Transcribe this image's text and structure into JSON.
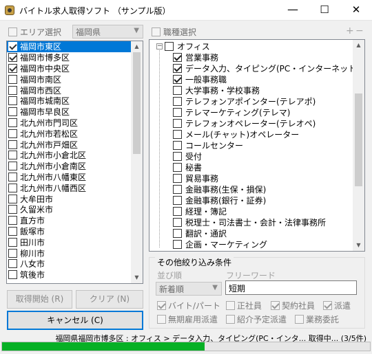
{
  "window": {
    "title": "バイトル求人取得ソフト （サンプル版）",
    "minimize": "—",
    "maximize": "☐",
    "close": "✕"
  },
  "area": {
    "checkbox_label": "エリア選択",
    "checked": false,
    "prefecture": "福岡県"
  },
  "area_list": [
    {
      "label": "福岡市東区",
      "checked": true,
      "selected": true
    },
    {
      "label": "福岡市博多区",
      "checked": true
    },
    {
      "label": "福岡市中央区",
      "checked": true
    },
    {
      "label": "福岡市南区",
      "checked": false
    },
    {
      "label": "福岡市西区",
      "checked": false
    },
    {
      "label": "福岡市城南区",
      "checked": false
    },
    {
      "label": "福岡市早良区",
      "checked": false
    },
    {
      "label": "北九州市門司区",
      "checked": false
    },
    {
      "label": "北九州市若松区",
      "checked": false
    },
    {
      "label": "北九州市戸畑区",
      "checked": false
    },
    {
      "label": "北九州市小倉北区",
      "checked": false
    },
    {
      "label": "北九州市小倉南区",
      "checked": false
    },
    {
      "label": "北九州市八幡東区",
      "checked": false
    },
    {
      "label": "北九州市八幡西区",
      "checked": false
    },
    {
      "label": "大牟田市",
      "checked": false
    },
    {
      "label": "久留米市",
      "checked": false
    },
    {
      "label": "直方市",
      "checked": false
    },
    {
      "label": "飯塚市",
      "checked": false
    },
    {
      "label": "田川市",
      "checked": false
    },
    {
      "label": "柳川市",
      "checked": false
    },
    {
      "label": "八女市",
      "checked": false
    },
    {
      "label": "筑後市",
      "checked": false
    }
  ],
  "buttons": {
    "start": "取得開始 (R)",
    "clear": "クリア (N)",
    "cancel": "キャンセル (C)"
  },
  "job": {
    "checkbox_label": "職種選択",
    "checked": false,
    "plus": "+",
    "minus": "−"
  },
  "job_tree": {
    "root": {
      "label": "オフィス",
      "checked": false,
      "expander": "−"
    },
    "children": [
      {
        "label": "営業事務",
        "checked": true
      },
      {
        "label": "データ入力、タイピング(PC・インターネット)",
        "checked": true
      },
      {
        "label": "一般事務職",
        "checked": true
      },
      {
        "label": "大学事務・学校事務",
        "checked": false
      },
      {
        "label": "テレフォンアポインター(テレアポ)",
        "checked": false
      },
      {
        "label": "テレマーケティング(テレマ)",
        "checked": false
      },
      {
        "label": "テレフォンオペレーター(テレオペ)",
        "checked": false
      },
      {
        "label": "メール(チャット)オペレーター",
        "checked": false
      },
      {
        "label": "コールセンター",
        "checked": false
      },
      {
        "label": "受付",
        "checked": false
      },
      {
        "label": "秘書",
        "checked": false
      },
      {
        "label": "貿易事務",
        "checked": false
      },
      {
        "label": "金融事務(生保・損保)",
        "checked": false
      },
      {
        "label": "金融事務(銀行・証券)",
        "checked": false
      },
      {
        "label": "経理・簿記",
        "checked": false
      },
      {
        "label": "税理士・司法書士・会計・法律事務所",
        "checked": false
      },
      {
        "label": "翻訳・通訳",
        "checked": false
      },
      {
        "label": "企画・マーケティング",
        "checked": false
      }
    ]
  },
  "filters": {
    "title": "その他絞り込み条件",
    "sort_label": "並び順",
    "sort_value": "新着順",
    "keyword_label": "フリーワード",
    "keyword_value": "短期",
    "options": [
      {
        "label": "バイト/パート",
        "checked": true
      },
      {
        "label": "正社員",
        "checked": false
      },
      {
        "label": "契約社員",
        "checked": true
      },
      {
        "label": "派遣",
        "checked": true
      },
      {
        "label": "無期雇用派遣",
        "checked": false
      },
      {
        "label": "紹介予定派遣",
        "checked": false
      },
      {
        "label": "業務委託",
        "checked": false
      }
    ]
  },
  "status": {
    "text": "福岡県福岡市博多区 : オフィス > データ入力、タイピング(PC・インタ... 取得中... (3/5件)",
    "progress": 0.55
  }
}
